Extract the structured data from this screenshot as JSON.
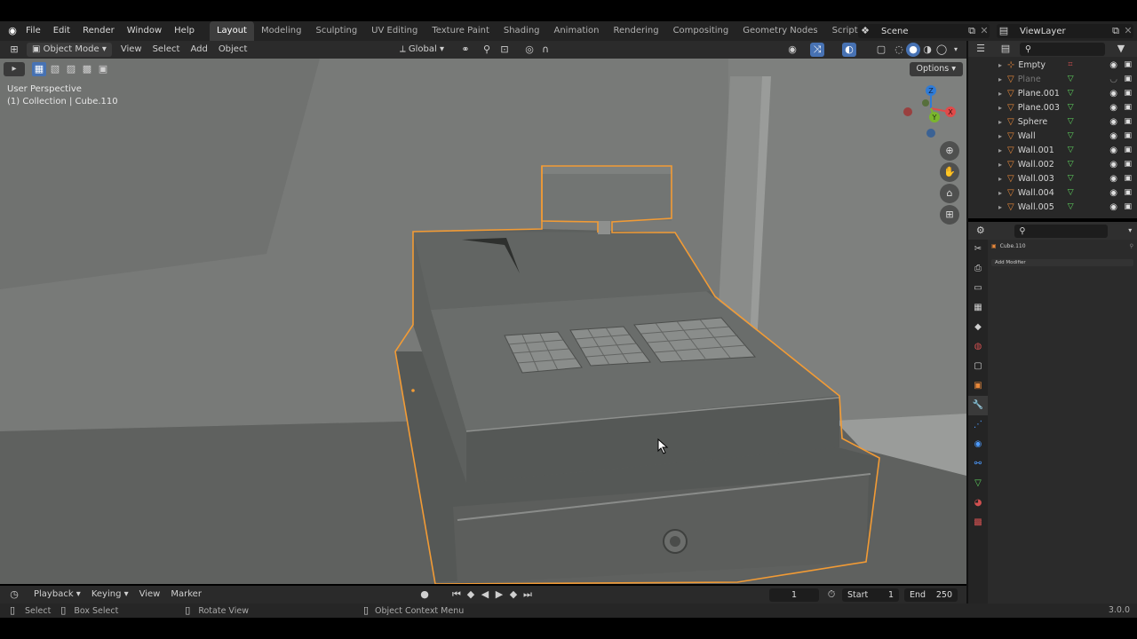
{
  "topbar": {
    "menus": [
      "File",
      "Edit",
      "Render",
      "Window",
      "Help"
    ],
    "workspaces": [
      "Layout",
      "Modeling",
      "Sculpting",
      "UV Editing",
      "Texture Paint",
      "Shading",
      "Animation",
      "Rendering",
      "Compositing",
      "Geometry Nodes",
      "Scripting"
    ],
    "active_workspace": "Layout",
    "add_tab": "+",
    "scene_label": "Scene",
    "viewlayer_label": "ViewLayer"
  },
  "viewport_header": {
    "mode": "Object Mode",
    "menus": [
      "View",
      "Select",
      "Add",
      "Object"
    ],
    "transform_orientation": "Global"
  },
  "viewport": {
    "perspective_label": "User Perspective",
    "collection_label": "(1) Collection | Cube.110",
    "options_label": "Options",
    "gizmo_labels": {
      "z": "Z",
      "y": "Y",
      "x": "X"
    }
  },
  "outliner": {
    "items": [
      {
        "name": "Empty",
        "type": "empty",
        "visible": true
      },
      {
        "name": "Plane",
        "type": "mesh",
        "visible": false
      },
      {
        "name": "Plane.001",
        "type": "mesh",
        "visible": true
      },
      {
        "name": "Plane.003",
        "type": "mesh",
        "visible": true
      },
      {
        "name": "Sphere",
        "type": "mesh",
        "visible": true
      },
      {
        "name": "Wall",
        "type": "mesh",
        "visible": true
      },
      {
        "name": "Wall.001",
        "type": "mesh",
        "visible": true
      },
      {
        "name": "Wall.002",
        "type": "mesh",
        "visible": true
      },
      {
        "name": "Wall.003",
        "type": "mesh",
        "visible": true
      },
      {
        "name": "Wall.004",
        "type": "mesh",
        "visible": true
      },
      {
        "name": "Wall.005",
        "type": "mesh",
        "visible": true
      }
    ]
  },
  "properties": {
    "object_name": "Cube.110",
    "add_modifier_label": "Add Modifier"
  },
  "timeline": {
    "menus": [
      "Playback",
      "Keying",
      "View",
      "Marker"
    ],
    "current_frame": "1",
    "start_label": "Start",
    "start_value": "1",
    "end_label": "End",
    "end_value": "250"
  },
  "statusbar": {
    "select": "Select",
    "box_select": "Box Select",
    "rotate_view": "Rotate View",
    "context_menu": "Object Context Menu",
    "version": "3.0.0"
  },
  "colors": {
    "selection_outline": "#f29b35",
    "active_tab": "#3d3d3d",
    "mesh_icon": "#5fd35f",
    "object_icon": "#e8883a"
  }
}
